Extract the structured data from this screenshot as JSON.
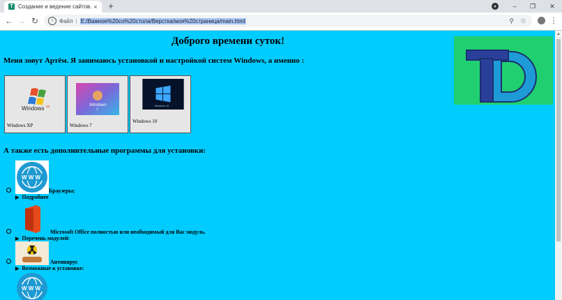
{
  "browser": {
    "tab_title": "Создание и ведение сайтов.",
    "tab_close": "×",
    "new_tab": "+",
    "file_label": "Файл",
    "url": "E:/Важное%20со%20стола/Верстка/моя%20страница/main.html",
    "back": "←",
    "forward": "→",
    "reload": "↻",
    "info": "i",
    "zoom": "⚲",
    "star": "☆",
    "menu": "⋮",
    "window_controls": {
      "minimize": "–",
      "maximize": "❐",
      "close": "✕"
    }
  },
  "page": {
    "title": "Доброго времени суток!",
    "intro": "Меня зовут Артём. Я занимаюсь установкой и настройкой систем Windows, а именно :",
    "cards": [
      {
        "label": "Windows XP"
      },
      {
        "label": "Windows 7"
      },
      {
        "label": "Windows 10"
      }
    ],
    "subheading": "А также есть дополнительные программы для установки:",
    "programs": [
      {
        "label": "Браузеры;",
        "details": "Подробнее",
        "icon": "www-globe-icon"
      },
      {
        "label": "Microsoft Office полностью или необходимый для Вас модуль.",
        "details": "Перечень модулей:",
        "icon": "office-icon"
      },
      {
        "label": "Антивирус",
        "details": "Возможные к установке:",
        "icon": "antivirus-icon"
      }
    ],
    "logo_letters": "TD",
    "colors": {
      "background": "#00ccff",
      "logo_bg": "#20d070",
      "logo_t": "#2a3f9a",
      "logo_d": "#1e9bd7"
    }
  }
}
